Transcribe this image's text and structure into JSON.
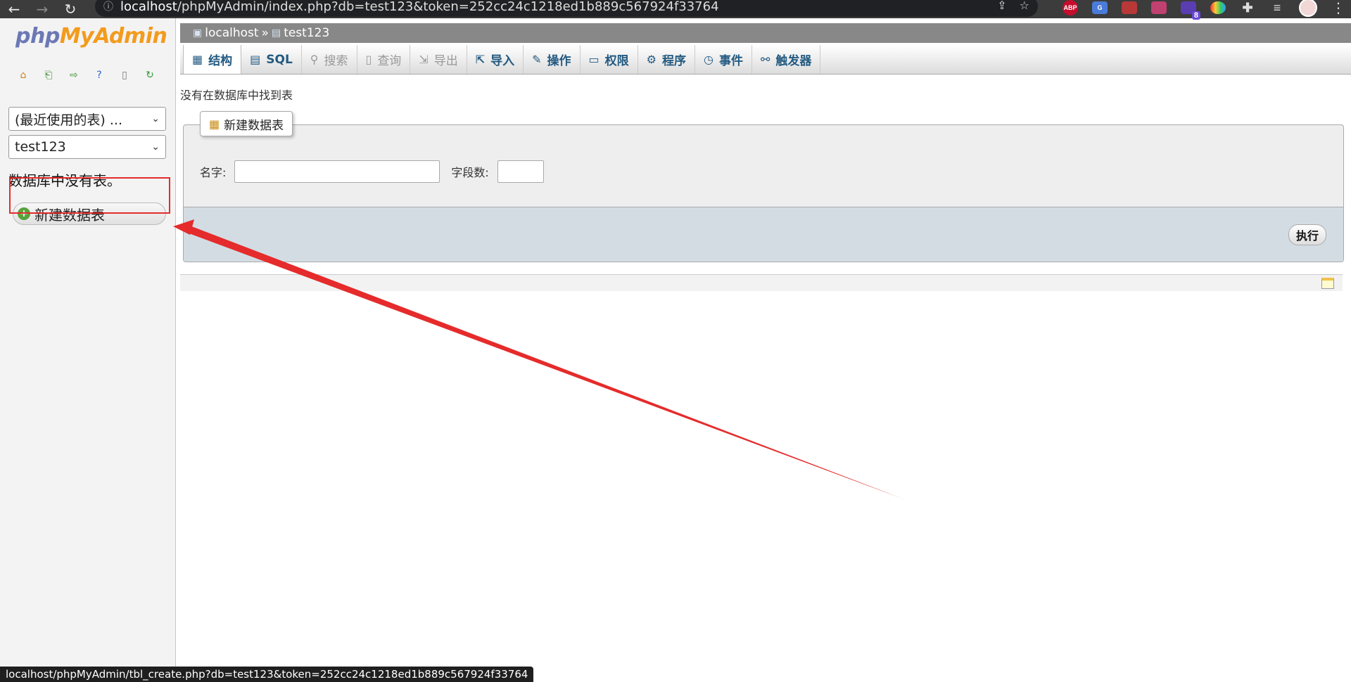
{
  "browser": {
    "url_host": "localhost",
    "url_path": "/phpMyAdmin/index.php?db=test123&token=252cc24c1218ed1b889c567924f33764",
    "ext_badge": "8",
    "ext_abp": "ABP",
    "ext_gt": "G"
  },
  "sidebar": {
    "logo_php": "php",
    "logo_myadmin": "MyAdmin",
    "recent_select": "(最近使用的表) ...",
    "db_select": "test123",
    "no_tables": "数据库中没有表。",
    "new_table": "新建数据表"
  },
  "breadcrumb": {
    "server": "localhost",
    "separator": "»",
    "database": "test123"
  },
  "tabs": {
    "structure": "结构",
    "sql": "SQL",
    "search": "搜索",
    "query": "查询",
    "export": "导出",
    "import": "导入",
    "operations": "操作",
    "privileges": "权限",
    "routines": "程序",
    "events": "事件",
    "triggers": "触发器"
  },
  "main": {
    "no_tables_msg": "没有在数据库中找到表",
    "create_legend": "新建数据表",
    "name_label": "名字:",
    "name_value": "",
    "fields_label": "字段数:",
    "fields_value": "",
    "go_button": "执行"
  },
  "status_url": "localhost/phpMyAdmin/tbl_create.php?db=test123&token=252cc24c1218ed1b889c567924f33764",
  "colors": {
    "accent_red": "#e52b2b",
    "tab_text": "#235a81",
    "logo_blue": "#6c78b5",
    "logo_orange": "#f39b1d"
  }
}
